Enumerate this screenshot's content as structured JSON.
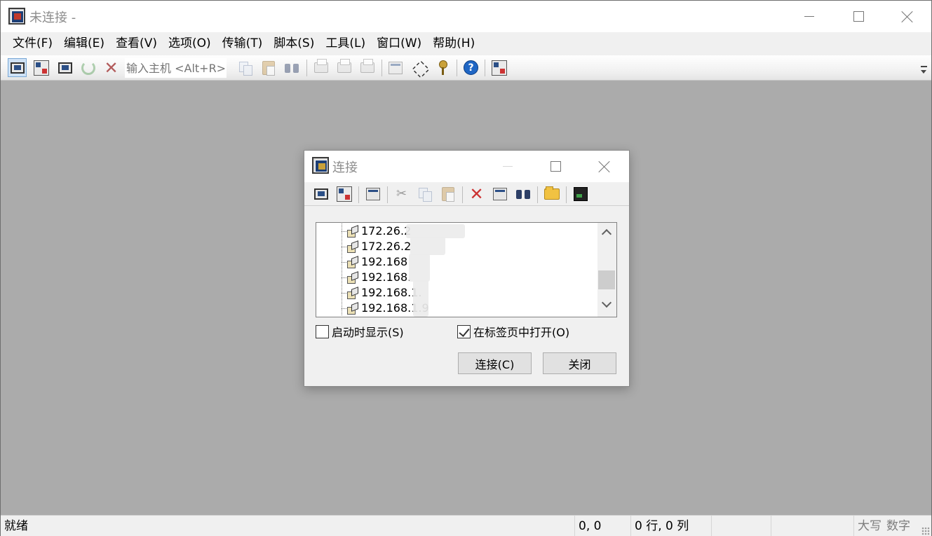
{
  "window": {
    "title": "未连接 -",
    "controls": {
      "minimize": "minimize",
      "maximize": "maximize",
      "close": "close"
    }
  },
  "menubar": {
    "items": [
      "文件(F)",
      "编辑(E)",
      "查看(V)",
      "选项(O)",
      "传输(T)",
      "脚本(S)",
      "工具(L)",
      "窗口(W)",
      "帮助(H)"
    ]
  },
  "toolbar": {
    "quick_connect_placeholder": "输入主机 <Alt+R>",
    "icons": [
      "connect-icon",
      "quick-connect-icon",
      "connect-in-tab-icon",
      "reconnect-icon",
      "disconnect-icon",
      "copy-icon",
      "paste-icon",
      "find-icon",
      "print-setup-icon",
      "print-screen-icon",
      "print-icon",
      "session-options-icon",
      "global-options-icon",
      "keymap-icon",
      "help-icon",
      "session-manager-icon"
    ]
  },
  "dialog": {
    "title": "连接",
    "tree_items": [
      "172.26.2",
      "172.26.2",
      "192.168",
      "192.168.",
      "192.168.1.",
      "192.168.1.9"
    ],
    "show_on_startup_label": "启动时显示(S)",
    "show_on_startup_checked": false,
    "open_in_tab_label": "在标签页中打开(O)",
    "open_in_tab_checked": true,
    "connect_button": "连接(C)",
    "close_button": "关闭",
    "toolbar_icons": [
      "quick-connect-icon",
      "connect-icon",
      "new-session-icon",
      "cut-icon",
      "copy-icon",
      "paste-icon",
      "delete-icon",
      "properties-icon",
      "find-icon",
      "new-folder-icon",
      "terminal-icon"
    ]
  },
  "statusbar": {
    "status": "就绪",
    "cursor_pos": "0, 0",
    "rows_cols": "0 行, 0 列",
    "caps": "大写",
    "num": "数字"
  }
}
